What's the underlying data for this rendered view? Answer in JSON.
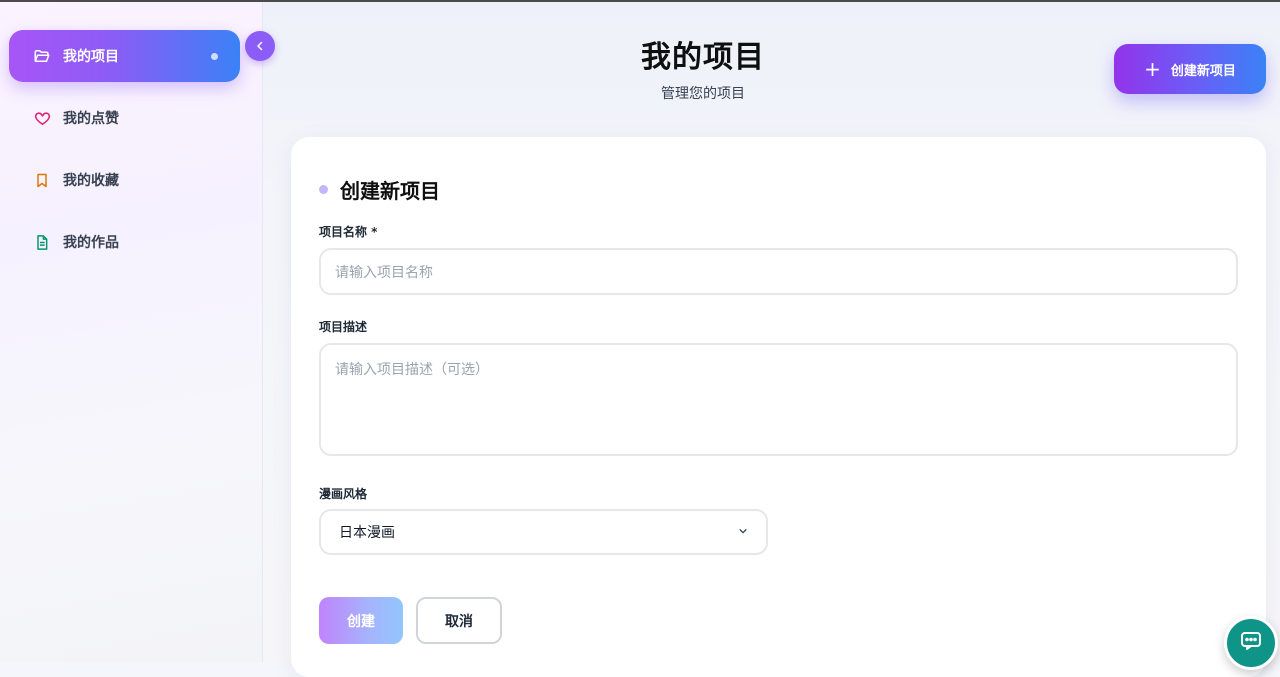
{
  "sidebar": {
    "items": [
      {
        "label": "我的项目",
        "icon": "folder-open-icon",
        "color": "#ffffff",
        "active": true
      },
      {
        "label": "我的点赞",
        "icon": "heart-icon",
        "color": "#db2777",
        "active": false
      },
      {
        "label": "我的收藏",
        "icon": "bookmark-icon",
        "color": "#d97706",
        "active": false
      },
      {
        "label": "我的作品",
        "icon": "document-icon",
        "color": "#059669",
        "active": false
      }
    ]
  },
  "header": {
    "title": "我的项目",
    "subtitle": "管理您的项目",
    "create_button": "创建新项目"
  },
  "form": {
    "title": "创建新项目",
    "name_label": "项目名称 *",
    "name_placeholder": "请输入项目名称",
    "desc_label": "项目描述",
    "desc_placeholder": "请输入项目描述（可选）",
    "style_label": "漫画风格",
    "style_selected": "日本漫画",
    "submit": "创建",
    "cancel": "取消"
  },
  "colors": {
    "accent_purple": "#8b5cf6",
    "accent_blue": "#3b82f6",
    "chat_fab": "#0f9488"
  }
}
